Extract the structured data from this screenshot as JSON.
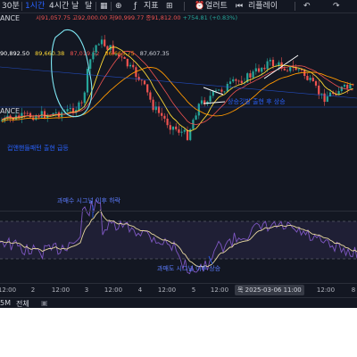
{
  "toolbar": {
    "timeframe_30m": "30분",
    "timeframe_1h": "1시간",
    "timeframe_4h": "4시간",
    "timeframe_day": "날",
    "timeframe_month": "달",
    "indicators_label": "지표",
    "alert_label": "얼러트",
    "replay_label": "리플레이",
    "active_color": "#2962ff"
  },
  "ohlc": {
    "open": "시91,057.75",
    "high": "고92,000.00",
    "low": "저90,999.77",
    "close": "종91,812.00",
    "change": "+754.81 (+0.83%)"
  },
  "indicator_values": [
    {
      "text": "90,892.50",
      "color": "#ffffff"
    },
    {
      "text": "89,660.38",
      "color": "#fdd835"
    },
    {
      "text": "87,019.52",
      "color": "#ef5350"
    },
    {
      "text": "86,663.75",
      "color": "#ff9800"
    },
    {
      "text": "87,607.35",
      "color": "#d1d4dc"
    }
  ],
  "symbol_fragments": {
    "top": "ANCE",
    "middle": "ANCE"
  },
  "annotations": {
    "cup_handle": "컵앤핸들패턴 출현 급등",
    "flag_breakout": "상승깃발 출현 후 상승",
    "overbought": "과매수 시그널 이후 하락",
    "oversold": "과매도 시그널 이후 상승"
  },
  "time_axis": {
    "ticks": [
      "12:00",
      "2",
      "12:00",
      "3",
      "12:00",
      "4",
      "12:00",
      "5",
      "12:00",
      "12:00",
      "8"
    ],
    "cursor_label": "목 2025-03-06  11:00"
  },
  "bottom_bar": {
    "range_5m": "5M",
    "range_all": "전체"
  },
  "colors": {
    "bull": "#26a69a",
    "bear": "#ef5350",
    "annotation_blue": "#2962ff",
    "highlight_cyan": "#7fe8f5",
    "rsi_line": "#7e57c2",
    "signal_line": "#e8d8a0"
  }
}
